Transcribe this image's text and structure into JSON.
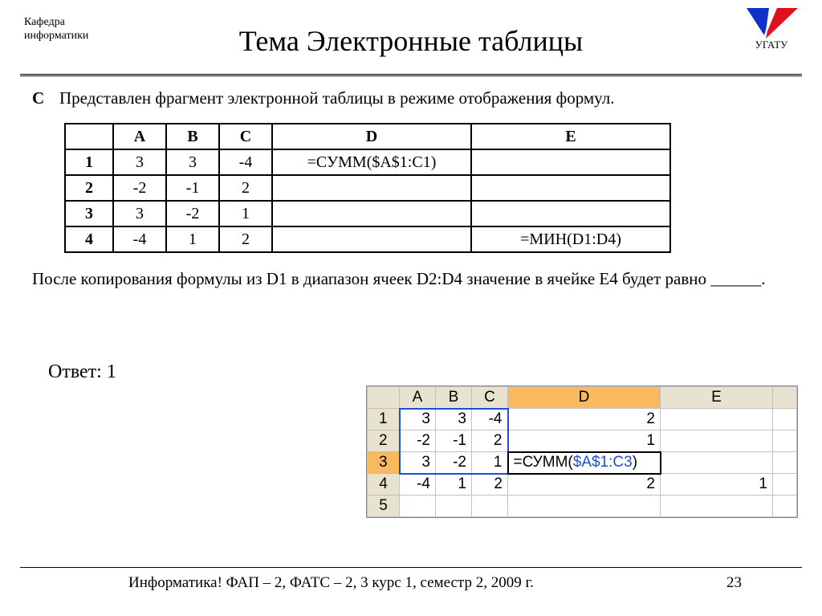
{
  "header": {
    "dept_line1": "Кафедра",
    "dept_line2": "информатики",
    "title": "Тема Электронные таблицы",
    "org": "УГАТУ"
  },
  "problem": {
    "letter": "C",
    "intro": "Представлен фрагмент электронной таблицы в режиме отображения формул.",
    "table": {
      "headers": [
        "",
        "A",
        "B",
        "C",
        "D",
        "E"
      ],
      "rows": [
        [
          "1",
          "3",
          "3",
          "-4",
          "=СУММ($A$1:C1)",
          ""
        ],
        [
          "2",
          "-2",
          "-1",
          "2",
          "",
          ""
        ],
        [
          "3",
          "3",
          "-2",
          "1",
          "",
          ""
        ],
        [
          "4",
          "-4",
          "1",
          "2",
          "",
          "=МИН(D1:D4)"
        ]
      ]
    },
    "after": "После копирования формулы из D1 в диапазон ячеек D2:D4 значение в ячейке E4 будет равно ______.",
    "answer_label": "Ответ:",
    "answer_value": "1"
  },
  "excel": {
    "headers": [
      "",
      "A",
      "B",
      "C",
      "D",
      "E",
      ""
    ],
    "rows": [
      [
        "1",
        "3",
        "3",
        "-4",
        "2",
        "",
        ""
      ],
      [
        "2",
        "-2",
        "-1",
        "2",
        "1",
        "",
        ""
      ],
      [
        "3",
        "3",
        "-2",
        "1",
        "=СУММ($A$1:C3)",
        "",
        ""
      ],
      [
        "4",
        "-4",
        "1",
        "2",
        "2",
        "1",
        ""
      ],
      [
        "5",
        "",
        "",
        "",
        "",
        "",
        ""
      ]
    ],
    "formula_prefix": "=СУММ(",
    "formula_ref": "$A$1:C3",
    "formula_suffix": ")"
  },
  "footer": {
    "text": "Информатика! ФАП – 2, ФАТС – 2, 3 курс 1, семестр 2, 2009 г.",
    "page": "23"
  }
}
